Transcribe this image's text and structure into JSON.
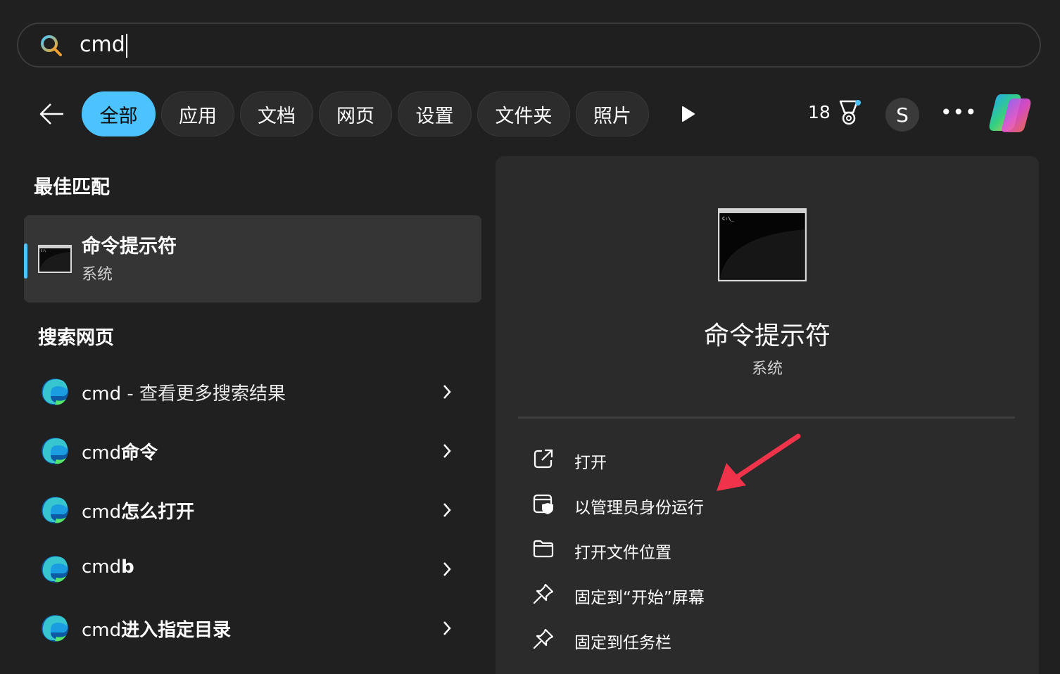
{
  "search": {
    "query": "cmd"
  },
  "filters": {
    "items": [
      {
        "label": "全部",
        "active": true
      },
      {
        "label": "应用",
        "active": false
      },
      {
        "label": "文档",
        "active": false
      },
      {
        "label": "网页",
        "active": false
      },
      {
        "label": "设置",
        "active": false
      },
      {
        "label": "文件夹",
        "active": false
      },
      {
        "label": "照片",
        "active": false
      }
    ]
  },
  "header": {
    "points": "18",
    "avatar_initial": "S",
    "more_label": "•••"
  },
  "best_match": {
    "section_title": "最佳匹配",
    "title": "命令提示符",
    "subtitle": "系统"
  },
  "web_search": {
    "section_title": "搜索网页",
    "items": [
      {
        "prefix": "cmd",
        "suffix": " - 查看更多搜索结果"
      },
      {
        "prefix": "cmd",
        "suffix": "命令"
      },
      {
        "prefix": "cmd",
        "suffix": "怎么打开"
      },
      {
        "prefix": "cmd",
        "suffix": "b"
      },
      {
        "prefix": "cmd",
        "suffix": "进入指定目录"
      }
    ]
  },
  "details": {
    "title": "命令提示符",
    "subtitle": "系统",
    "actions": [
      {
        "label": "打开",
        "icon": "open-external-icon"
      },
      {
        "label": "以管理员身份运行",
        "icon": "shield-window-icon"
      },
      {
        "label": "打开文件位置",
        "icon": "folder-icon"
      },
      {
        "label": "固定到“开始”屏幕",
        "icon": "pin-icon"
      },
      {
        "label": "固定到任务栏",
        "icon": "pin-icon"
      }
    ]
  },
  "colors": {
    "accent": "#4cc2ff",
    "background": "#202020",
    "panel": "#2b2b2b",
    "annotation_arrow": "#f0334a"
  }
}
